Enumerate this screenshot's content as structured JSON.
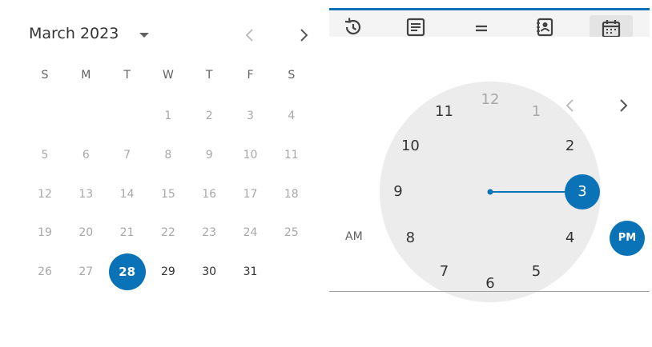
{
  "calendar": {
    "month_label": "March 2023",
    "weekdays": [
      "S",
      "M",
      "T",
      "W",
      "T",
      "F",
      "S"
    ],
    "weeks": [
      [
        null,
        null,
        null,
        "1",
        "2",
        "3",
        "4"
      ],
      [
        "5",
        "6",
        "7",
        "8",
        "9",
        "10",
        "11"
      ],
      [
        "12",
        "13",
        "14",
        "15",
        "16",
        "17",
        "18"
      ],
      [
        "19",
        "20",
        "21",
        "22",
        "23",
        "24",
        "25"
      ],
      [
        "26",
        "27",
        "28",
        "29",
        "30",
        "31",
        null
      ]
    ],
    "selected_day": "28",
    "enabled_from_day": "28"
  },
  "time_picker": {
    "tabs": [
      {
        "icon": "history-icon"
      },
      {
        "icon": "notes-icon"
      },
      {
        "icon": "menu-icon"
      },
      {
        "icon": "contact-book-icon"
      },
      {
        "icon": "calendar-icon",
        "active": true
      }
    ],
    "hours": [
      "12",
      "1",
      "2",
      "3",
      "4",
      "5",
      "6",
      "7",
      "8",
      "9",
      "10",
      "11"
    ],
    "muted_hours": [
      "12",
      "1"
    ],
    "selected_hour": "3",
    "am_label": "AM",
    "pm_label": "PM",
    "selected_period": "PM"
  },
  "colors": {
    "accent": "#0a72b6",
    "dial_face": "#ececec",
    "disabled_text": "#a8a8a8",
    "enabled_text": "#333333"
  }
}
